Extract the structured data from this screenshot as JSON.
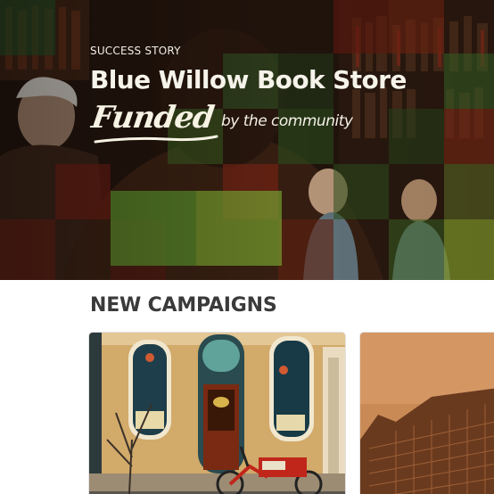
{
  "hero": {
    "kicker": "SUCCESS STORY",
    "title": "Blue Willow Book Store",
    "funded_word": "Funded",
    "funded_suffix": "by the community"
  },
  "campaigns": {
    "heading": "NEW CAMPAIGNS",
    "cards": [
      {
        "image": "bookstore-storefront-with-cargo-bike"
      },
      {
        "image": "sepia-building"
      }
    ]
  },
  "colors": {
    "hero_text": "#f4f0e6",
    "mosaic_green": "#5f9a2e",
    "mosaic_red": "#7a1f14",
    "section_heading": "#3a3a3a",
    "storefront_wall": "#d2aa6a",
    "card_sepia": "#c98a55"
  }
}
